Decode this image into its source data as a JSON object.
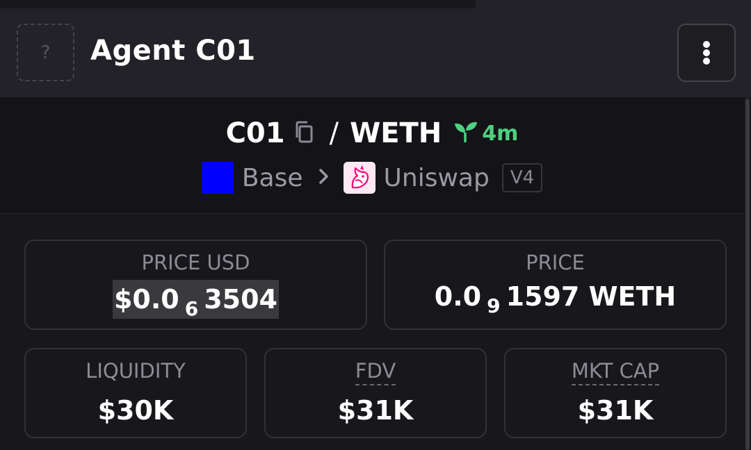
{
  "header": {
    "avatar_placeholder": "?",
    "title": "Agent C01"
  },
  "pair": {
    "base_symbol": "C01",
    "separator": "/",
    "quote_symbol": "WETH",
    "age": "4m"
  },
  "route": {
    "chain": "Base",
    "dex": "Uniswap",
    "version": "V4"
  },
  "stats": {
    "price_usd": {
      "label": "PRICE USD",
      "prefix": "$0.0",
      "zeros": "6",
      "digits": "3504"
    },
    "price": {
      "label": "PRICE",
      "prefix": "0.0",
      "zeros": "9",
      "digits": "1597",
      "unit": "WETH"
    },
    "liquidity": {
      "label": "LIQUIDITY",
      "value": "$30K"
    },
    "fdv": {
      "label": "FDV",
      "value": "$31K"
    },
    "mkt_cap": {
      "label": "MKT CAP",
      "value": "$31K"
    }
  },
  "colors": {
    "accent_green": "#4dd080",
    "base_chain_blue": "#0000ff",
    "uniswap_pink": "#ff007a"
  },
  "icons": [
    "copy-icon",
    "leaf-icon",
    "chevron-right-icon",
    "base-chain-icon",
    "uniswap-logo-icon",
    "more-vertical-icon"
  ]
}
